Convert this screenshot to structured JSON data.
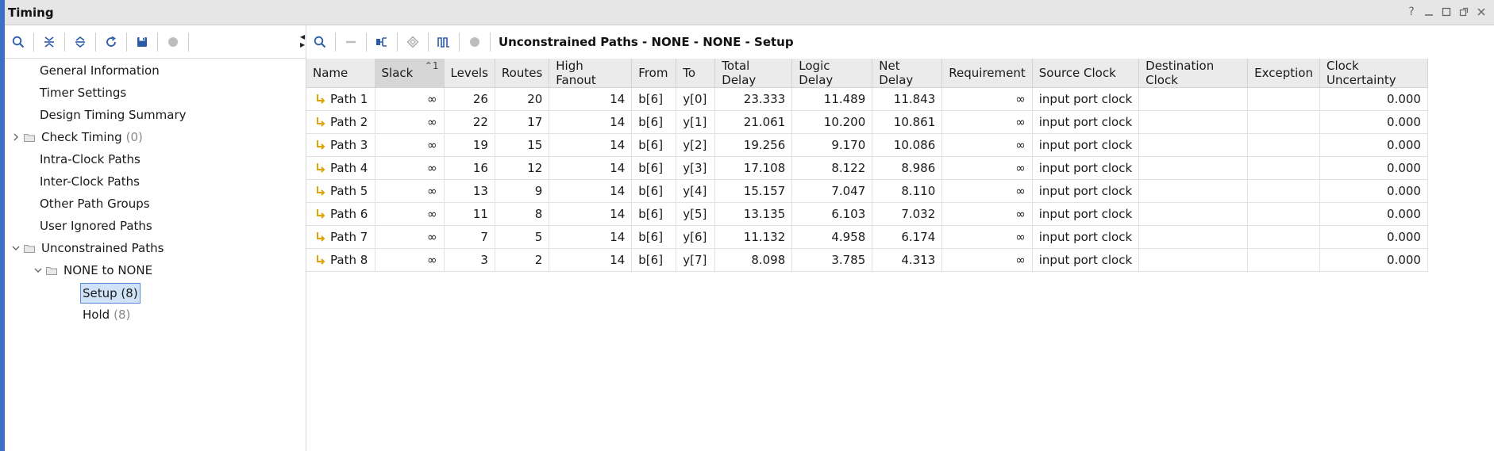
{
  "window": {
    "title": "Timing"
  },
  "window_controls": [
    "?",
    "minimize",
    "maximize",
    "restore",
    "close"
  ],
  "tree": {
    "items": [
      {
        "label": "General Information",
        "count": ""
      },
      {
        "label": "Timer Settings",
        "count": ""
      },
      {
        "label": "Design Timing Summary",
        "count": ""
      },
      {
        "label": "Check Timing",
        "count": "(0)"
      },
      {
        "label": "Intra-Clock Paths",
        "count": ""
      },
      {
        "label": "Inter-Clock Paths",
        "count": ""
      },
      {
        "label": "Other Path Groups",
        "count": ""
      },
      {
        "label": "User Ignored Paths",
        "count": ""
      },
      {
        "label": "Unconstrained Paths",
        "count": ""
      },
      {
        "label": "NONE to NONE",
        "count": ""
      },
      {
        "label": "Setup (8)",
        "count": ""
      },
      {
        "label": "Hold",
        "count": "(8)"
      }
    ]
  },
  "main": {
    "title": "Unconstrained Paths - NONE - NONE - Setup",
    "sort_indicator": "1",
    "columns": [
      "Name",
      "Slack",
      "Levels",
      "Routes",
      "High Fanout",
      "From",
      "To",
      "Total Delay",
      "Logic Delay",
      "Net Delay",
      "Requirement",
      "Source Clock",
      "Destination Clock",
      "Exception",
      "Clock Uncertainty"
    ],
    "rows": [
      [
        "Path 1",
        "∞",
        "26",
        "20",
        "14",
        "b[6]",
        "y[0]",
        "23.333",
        "11.489",
        "11.843",
        "∞",
        "input port clock",
        "",
        "",
        "0.000"
      ],
      [
        "Path 2",
        "∞",
        "22",
        "17",
        "14",
        "b[6]",
        "y[1]",
        "21.061",
        "10.200",
        "10.861",
        "∞",
        "input port clock",
        "",
        "",
        "0.000"
      ],
      [
        "Path 3",
        "∞",
        "19",
        "15",
        "14",
        "b[6]",
        "y[2]",
        "19.256",
        "9.170",
        "10.086",
        "∞",
        "input port clock",
        "",
        "",
        "0.000"
      ],
      [
        "Path 4",
        "∞",
        "16",
        "12",
        "14",
        "b[6]",
        "y[3]",
        "17.108",
        "8.122",
        "8.986",
        "∞",
        "input port clock",
        "",
        "",
        "0.000"
      ],
      [
        "Path 5",
        "∞",
        "13",
        "9",
        "14",
        "b[6]",
        "y[4]",
        "15.157",
        "7.047",
        "8.110",
        "∞",
        "input port clock",
        "",
        "",
        "0.000"
      ],
      [
        "Path 6",
        "∞",
        "11",
        "8",
        "14",
        "b[6]",
        "y[5]",
        "13.135",
        "6.103",
        "7.032",
        "∞",
        "input port clock",
        "",
        "",
        "0.000"
      ],
      [
        "Path 7",
        "∞",
        "7",
        "5",
        "14",
        "b[6]",
        "y[6]",
        "11.132",
        "4.958",
        "6.174",
        "∞",
        "input port clock",
        "",
        "",
        "0.000"
      ],
      [
        "Path 8",
        "∞",
        "3",
        "2",
        "14",
        "b[6]",
        "y[7]",
        "8.098",
        "3.785",
        "4.313",
        "∞",
        "input port clock",
        "",
        "",
        "0.000"
      ]
    ]
  },
  "colors": {
    "accent": "#3d6fc4",
    "path_icon": "#e0a400",
    "selection": "#cfe2f8"
  }
}
